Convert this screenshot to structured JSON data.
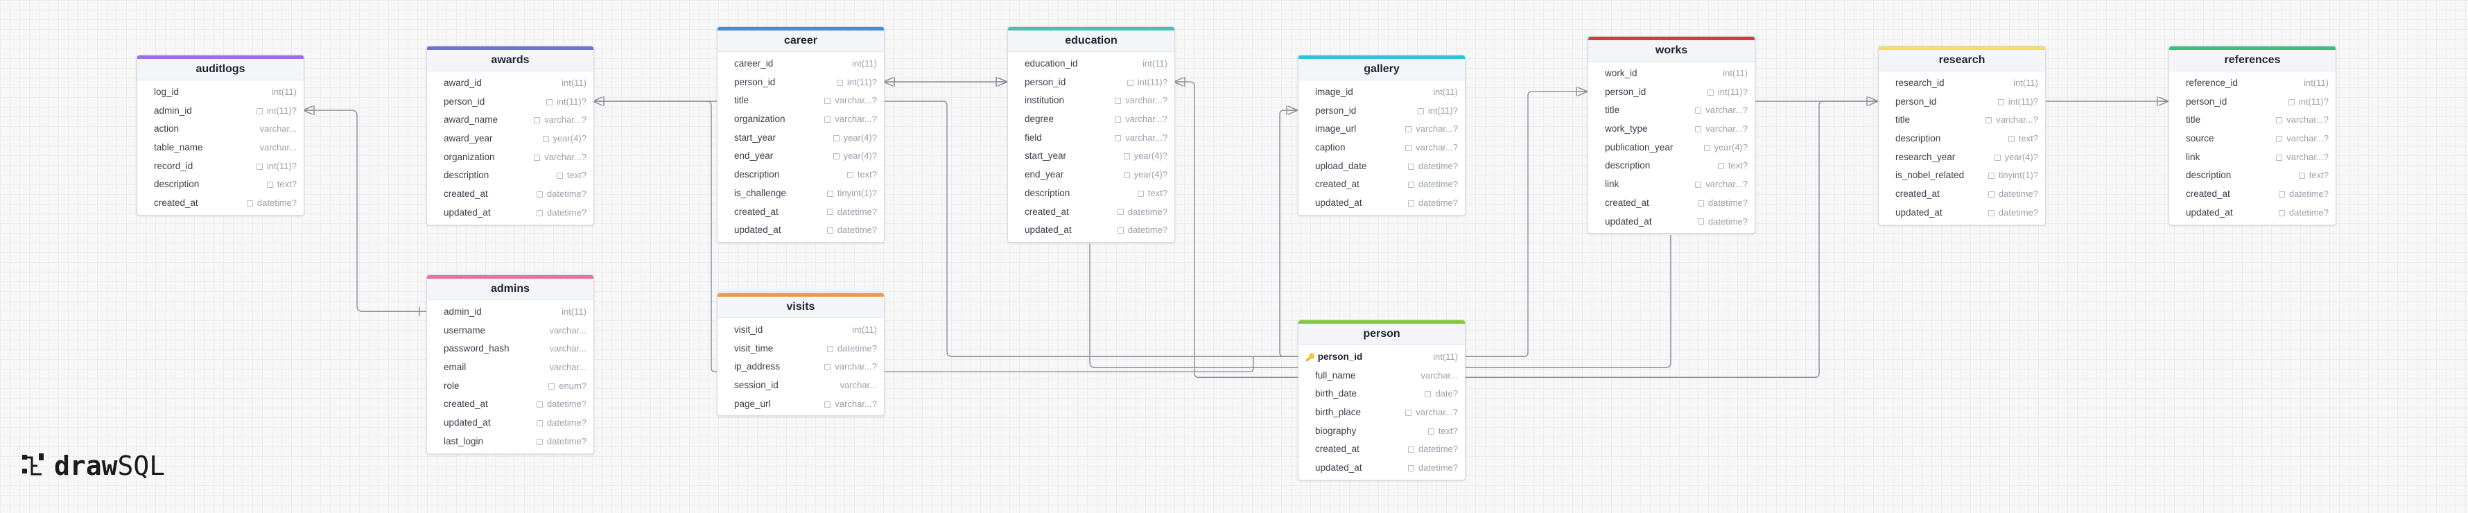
{
  "app": {
    "brand_left": "draw",
    "brand_right": "SQL"
  },
  "tables": [
    {
      "id": "auditlogs",
      "name": "auditlogs",
      "color": "#9b6fdc",
      "columns": [
        {
          "name": "log_id",
          "type": "int(11)",
          "nullable": false
        },
        {
          "name": "admin_id",
          "type": "int(11)?",
          "nullable": true
        },
        {
          "name": "action",
          "type": "varchar...",
          "nullable": false
        },
        {
          "name": "table_name",
          "type": "varchar...",
          "nullable": false
        },
        {
          "name": "record_id",
          "type": "int(11)?",
          "nullable": true
        },
        {
          "name": "description",
          "type": "text?",
          "nullable": true
        },
        {
          "name": "created_at",
          "type": "datetime?",
          "nullable": true
        }
      ]
    },
    {
      "id": "awards",
      "name": "awards",
      "color": "#6a70d6",
      "columns": [
        {
          "name": "award_id",
          "type": "int(11)",
          "nullable": false
        },
        {
          "name": "person_id",
          "type": "int(11)?",
          "nullable": true
        },
        {
          "name": "award_name",
          "type": "varchar...?",
          "nullable": true
        },
        {
          "name": "award_year",
          "type": "year(4)?",
          "nullable": true
        },
        {
          "name": "organization",
          "type": "varchar...?",
          "nullable": true
        },
        {
          "name": "description",
          "type": "text?",
          "nullable": true
        },
        {
          "name": "created_at",
          "type": "datetime?",
          "nullable": true
        },
        {
          "name": "updated_at",
          "type": "datetime?",
          "nullable": true
        }
      ]
    },
    {
      "id": "career",
      "name": "career",
      "color": "#3f8fd8",
      "columns": [
        {
          "name": "career_id",
          "type": "int(11)",
          "nullable": false
        },
        {
          "name": "person_id",
          "type": "int(11)?",
          "nullable": true
        },
        {
          "name": "title",
          "type": "varchar...?",
          "nullable": true
        },
        {
          "name": "organization",
          "type": "varchar...?",
          "nullable": true
        },
        {
          "name": "start_year",
          "type": "year(4)?",
          "nullable": true
        },
        {
          "name": "end_year",
          "type": "year(4)?",
          "nullable": true
        },
        {
          "name": "description",
          "type": "text?",
          "nullable": true
        },
        {
          "name": "is_challenge",
          "type": "tinyint(1)?",
          "nullable": true
        },
        {
          "name": "created_at",
          "type": "datetime?",
          "nullable": true
        },
        {
          "name": "updated_at",
          "type": "datetime?",
          "nullable": true
        }
      ]
    },
    {
      "id": "education",
      "name": "education",
      "color": "#4dbfae",
      "columns": [
        {
          "name": "education_id",
          "type": "int(11)",
          "nullable": false
        },
        {
          "name": "person_id",
          "type": "int(11)?",
          "nullable": true
        },
        {
          "name": "institution",
          "type": "varchar...?",
          "nullable": true
        },
        {
          "name": "degree",
          "type": "varchar...?",
          "nullable": true
        },
        {
          "name": "field",
          "type": "varchar...?",
          "nullable": true
        },
        {
          "name": "start_year",
          "type": "year(4)?",
          "nullable": true
        },
        {
          "name": "end_year",
          "type": "year(4)?",
          "nullable": true
        },
        {
          "name": "description",
          "type": "text?",
          "nullable": true
        },
        {
          "name": "created_at",
          "type": "datetime?",
          "nullable": true
        },
        {
          "name": "updated_at",
          "type": "datetime?",
          "nullable": true
        }
      ]
    },
    {
      "id": "gallery",
      "name": "gallery",
      "color": "#2fc3e0",
      "columns": [
        {
          "name": "image_id",
          "type": "int(11)",
          "nullable": false
        },
        {
          "name": "person_id",
          "type": "int(11)?",
          "nullable": true
        },
        {
          "name": "image_url",
          "type": "varchar...?",
          "nullable": true
        },
        {
          "name": "caption",
          "type": "varchar...?",
          "nullable": true
        },
        {
          "name": "upload_date",
          "type": "datetime?",
          "nullable": true
        },
        {
          "name": "created_at",
          "type": "datetime?",
          "nullable": true
        },
        {
          "name": "updated_at",
          "type": "datetime?",
          "nullable": true
        }
      ]
    },
    {
      "id": "works",
      "name": "works",
      "color": "#d63a3a",
      "columns": [
        {
          "name": "work_id",
          "type": "int(11)",
          "nullable": false
        },
        {
          "name": "person_id",
          "type": "int(11)?",
          "nullable": true
        },
        {
          "name": "title",
          "type": "varchar...?",
          "nullable": true
        },
        {
          "name": "work_type",
          "type": "varchar...?",
          "nullable": true
        },
        {
          "name": "publication_year",
          "type": "year(4)?",
          "nullable": true
        },
        {
          "name": "description",
          "type": "text?",
          "nullable": true
        },
        {
          "name": "link",
          "type": "varchar...?",
          "nullable": true
        },
        {
          "name": "created_at",
          "type": "datetime?",
          "nullable": true
        },
        {
          "name": "updated_at",
          "type": "datetime?",
          "nullable": true
        }
      ]
    },
    {
      "id": "research",
      "name": "research",
      "color": "#f2e05a",
      "columns": [
        {
          "name": "research_id",
          "type": "int(11)",
          "nullable": false
        },
        {
          "name": "person_id",
          "type": "int(11)?",
          "nullable": true
        },
        {
          "name": "title",
          "type": "varchar...?",
          "nullable": true
        },
        {
          "name": "description",
          "type": "text?",
          "nullable": true
        },
        {
          "name": "research_year",
          "type": "year(4)?",
          "nullable": true
        },
        {
          "name": "is_nobel_related",
          "type": "tinyint(1)?",
          "nullable": true
        },
        {
          "name": "created_at",
          "type": "datetime?",
          "nullable": true
        },
        {
          "name": "updated_at",
          "type": "datetime?",
          "nullable": true
        }
      ]
    },
    {
      "id": "references",
      "name": "references",
      "color": "#3cbf7a",
      "columns": [
        {
          "name": "reference_id",
          "type": "int(11)",
          "nullable": false
        },
        {
          "name": "person_id",
          "type": "int(11)?",
          "nullable": true
        },
        {
          "name": "title",
          "type": "varchar...?",
          "nullable": true
        },
        {
          "name": "source",
          "type": "varchar...?",
          "nullable": true
        },
        {
          "name": "link",
          "type": "varchar...?",
          "nullable": true
        },
        {
          "name": "description",
          "type": "text?",
          "nullable": true
        },
        {
          "name": "created_at",
          "type": "datetime?",
          "nullable": true
        },
        {
          "name": "updated_at",
          "type": "datetime?",
          "nullable": true
        }
      ]
    },
    {
      "id": "admins",
      "name": "admins",
      "color": "#e8709c",
      "columns": [
        {
          "name": "admin_id",
          "type": "int(11)",
          "nullable": false
        },
        {
          "name": "username",
          "type": "varchar...",
          "nullable": false
        },
        {
          "name": "password_hash",
          "type": "varchar...",
          "nullable": false
        },
        {
          "name": "email",
          "type": "varchar...",
          "nullable": false
        },
        {
          "name": "role",
          "type": "enum?",
          "nullable": true
        },
        {
          "name": "created_at",
          "type": "datetime?",
          "nullable": true
        },
        {
          "name": "updated_at",
          "type": "datetime?",
          "nullable": true
        },
        {
          "name": "last_login",
          "type": "datetime?",
          "nullable": true
        }
      ]
    },
    {
      "id": "visits",
      "name": "visits",
      "color": "#ef9a4a",
      "columns": [
        {
          "name": "visit_id",
          "type": "int(11)",
          "nullable": false
        },
        {
          "name": "visit_time",
          "type": "datetime?",
          "nullable": true
        },
        {
          "name": "ip_address",
          "type": "varchar...?",
          "nullable": true
        },
        {
          "name": "session_id",
          "type": "varchar...",
          "nullable": false
        },
        {
          "name": "page_url",
          "type": "varchar...?",
          "nullable": true
        }
      ]
    },
    {
      "id": "person",
      "name": "person",
      "color": "#86c93a",
      "columns": [
        {
          "name": "person_id",
          "type": "int(11)",
          "nullable": false,
          "pk": true
        },
        {
          "name": "full_name",
          "type": "varchar...",
          "nullable": false
        },
        {
          "name": "birth_date",
          "type": "date?",
          "nullable": true
        },
        {
          "name": "birth_place",
          "type": "varchar...?",
          "nullable": true
        },
        {
          "name": "biography",
          "type": "text?",
          "nullable": true
        },
        {
          "name": "created_at",
          "type": "datetime?",
          "nullable": true
        },
        {
          "name": "updated_at",
          "type": "datetime?",
          "nullable": true
        }
      ]
    }
  ],
  "relations": [
    {
      "from": "auditlogs.admin_id",
      "to": "admins.admin_id"
    },
    {
      "from": "awards.person_id",
      "to": "person.person_id"
    },
    {
      "from": "career.person_id",
      "to": "person.person_id"
    },
    {
      "from": "education.person_id",
      "to": "person.person_id"
    },
    {
      "from": "gallery.person_id",
      "to": "person.person_id"
    },
    {
      "from": "works.person_id",
      "to": "person.person_id"
    },
    {
      "from": "research.person_id",
      "to": "person.person_id"
    },
    {
      "from": "references.person_id",
      "to": "person.person_id"
    }
  ]
}
